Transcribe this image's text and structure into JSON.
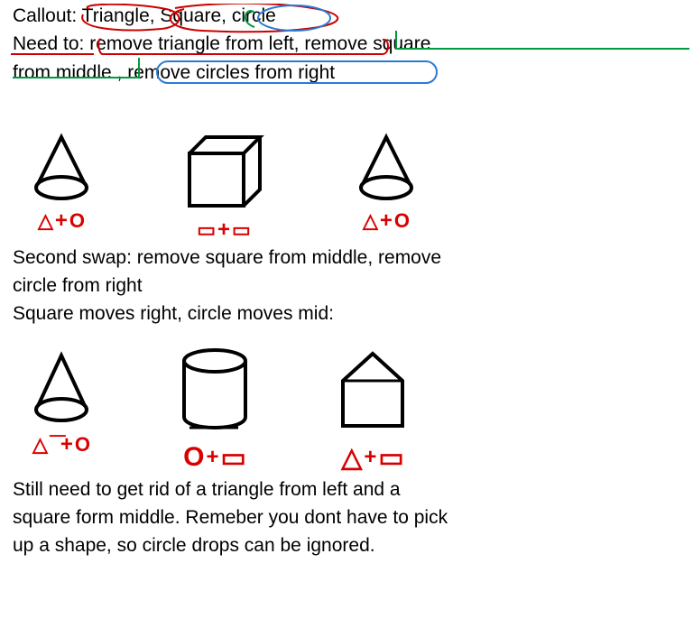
{
  "header": {
    "line1_label": "Callout:",
    "line1_words": "Triangle, Square, circle",
    "line2a": "Need to:",
    "line2b": "remove triangle from left,",
    "line2c": "remove square",
    "line3a": "from middle",
    "line3b": ", remove circles from right"
  },
  "row1": {
    "c1": {
      "f_left": "△",
      "f_mid": "+",
      "f_right": "O"
    },
    "c2": {
      "f_left": "▭",
      "f_mid": "+",
      "f_right": "▭"
    },
    "c3": {
      "f_left": "△",
      "f_mid": "+",
      "f_right": "O"
    }
  },
  "mid_text": {
    "l1": "Second swap: remove square from middle, remove",
    "l2": "circle from right",
    "l3": "Square moves right, circle moves mid:"
  },
  "row2": {
    "c1": {
      "f_left": "△",
      "f_mid": "+",
      "f_right": "O",
      "bar": "—"
    },
    "c2": {
      "f_left": "O",
      "f_mid": "+",
      "f_right": "▭"
    },
    "c3": {
      "f_left": "△",
      "f_mid": "+",
      "f_right": "▭"
    }
  },
  "bottom_text": {
    "l1": "Still need to get rid of a triangle from left and a",
    "l2": "square form middle. Remeber you dont have to pick",
    "l3": "up a shape, so circle drops can be ignored."
  }
}
